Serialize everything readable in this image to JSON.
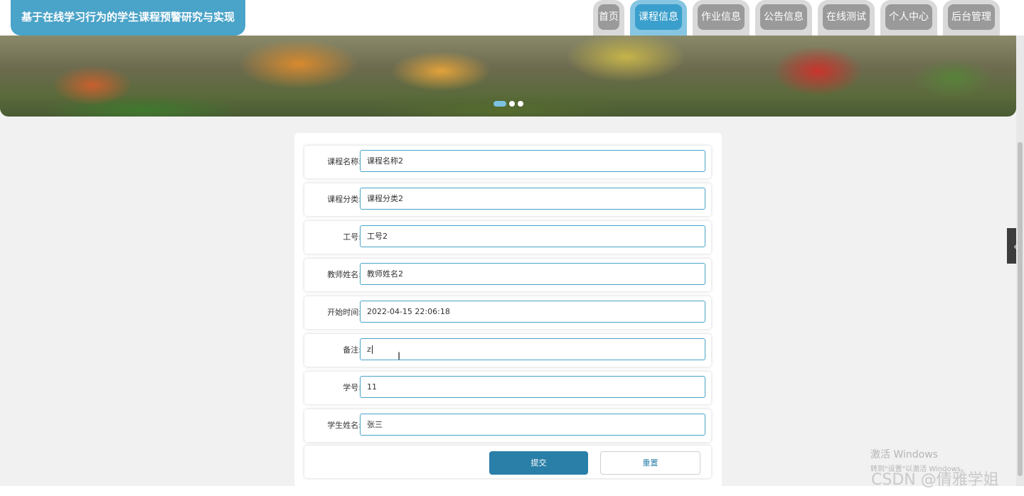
{
  "header": {
    "site_title": "基于在线学习行为的学生课程预警研究与实现",
    "nav": [
      {
        "label": "首页"
      },
      {
        "label": "课程信息"
      },
      {
        "label": "作业信息"
      },
      {
        "label": "公告信息"
      },
      {
        "label": "在线测试"
      },
      {
        "label": "个人中心"
      },
      {
        "label": "后台管理"
      }
    ],
    "active_nav": "课程信息"
  },
  "banner": {
    "slide_count": 3,
    "active_slide": 1
  },
  "form": {
    "fields": [
      {
        "label": "课程名称:",
        "value": "课程名称2"
      },
      {
        "label": "课程分类:",
        "value": "课程分类2"
      },
      {
        "label": "工号:",
        "value": "工号2"
      },
      {
        "label": "教师姓名:",
        "value": "教师姓名2"
      },
      {
        "label": "开始时间:",
        "value": "2022-04-15 22:06:18"
      },
      {
        "label": "备注:",
        "value": "z"
      },
      {
        "label": "学号:",
        "value": "11"
      },
      {
        "label": "学生姓名:",
        "value": "张三"
      }
    ],
    "submit_label": "提交",
    "reset_label": "重置"
  },
  "side_toggle": {
    "glyph": "‹"
  },
  "watermark": {
    "windows_line1": "激活 Windows",
    "windows_line2": "转到\"设置\"以激活 Windows。",
    "csdn": "CSDN @倩雅学姐"
  },
  "colors": {
    "accent": "#4aa3c8",
    "active_tab": "#3a9fcc",
    "inactive_tab": "#9a9a9a",
    "submit_button": "#2a7fa8"
  }
}
